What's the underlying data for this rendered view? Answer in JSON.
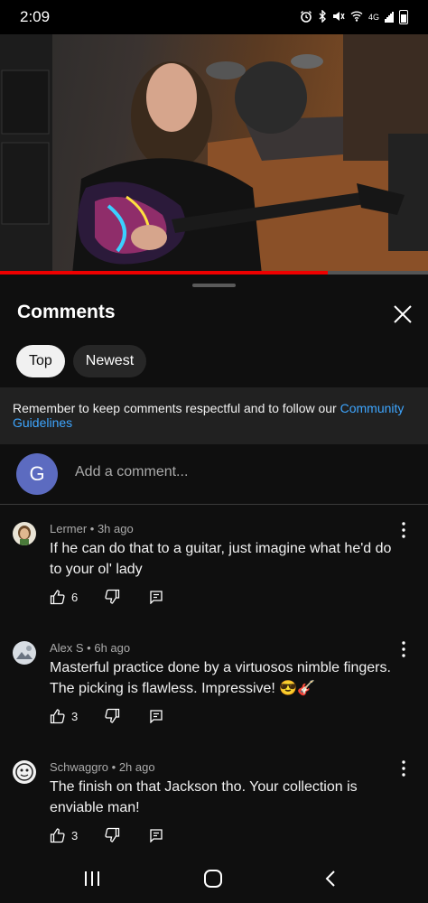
{
  "status_bar": {
    "time": "2:09",
    "network_label": "4G",
    "icons": [
      "alarm-icon",
      "bluetooth-icon",
      "mute-icon",
      "wifi-icon",
      "signal-icon",
      "battery-icon"
    ]
  },
  "video": {
    "progress_fraction": 0.765,
    "progress_color": "#ee0000"
  },
  "comments_panel": {
    "title": "Comments",
    "filters": [
      {
        "label": "Top",
        "active": true
      },
      {
        "label": "Newest",
        "active": false
      }
    ],
    "notice_text": "Remember to keep comments respectful and to follow our ",
    "notice_link": "Community Guidelines",
    "add_comment": {
      "avatar_letter": "G",
      "avatar_color": "#5c6bc0",
      "placeholder": "Add a comment..."
    },
    "comments": [
      {
        "author_meta": "Lermer • 3h ago",
        "text": "If he can do that to a guitar, just imagine what he'd do to your ol' lady",
        "likes": "6"
      },
      {
        "author_meta": "Alex S • 6h ago",
        "text": "Masterful practice done by a virtuosos nimble fingers. The picking is flawless. Impressive! 😎🎸",
        "likes": "3"
      },
      {
        "author_meta": "Schwaggro • 2h ago",
        "text": "The finish on that Jackson tho. Your collection is enviable man!",
        "likes": "3"
      }
    ]
  },
  "colors": {
    "background": "#0f0f0f",
    "link": "#3ea6ff",
    "notice_bg": "#212121",
    "chip_active_bg": "#f1f1f1",
    "chip_inactive_bg": "#272727"
  }
}
